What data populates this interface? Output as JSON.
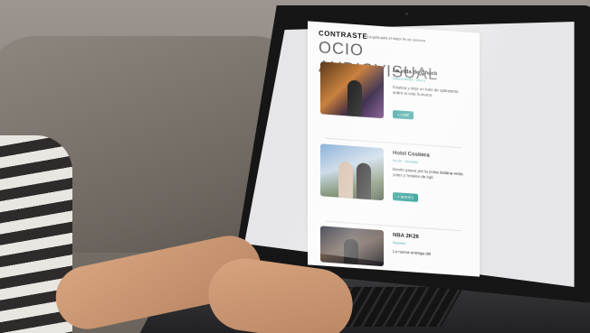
{
  "newsletter": {
    "brand": "CONTRASTE",
    "tagline": "La guía para el mejor fin de semana",
    "section_title": "OCIO AUDIOVISUAL"
  },
  "cards": [
    {
      "title": "La vida de Chuck",
      "genre": "Ciencia ficción · Drama",
      "description": "Cautiva y deja un halo de optimismo sobre la vida humana",
      "cta": "+ CINE"
    },
    {
      "title": "Hotel Costiera",
      "genre": "Acción · Comedia",
      "description": "Bonito paseo por la costa italiana entre yates y hoteles de lujo",
      "cta": "+ SERIES"
    },
    {
      "title": "NBA 2K26",
      "genre": "Deportes",
      "description": "La nueva entrega del",
      "cta": ""
    }
  ]
}
